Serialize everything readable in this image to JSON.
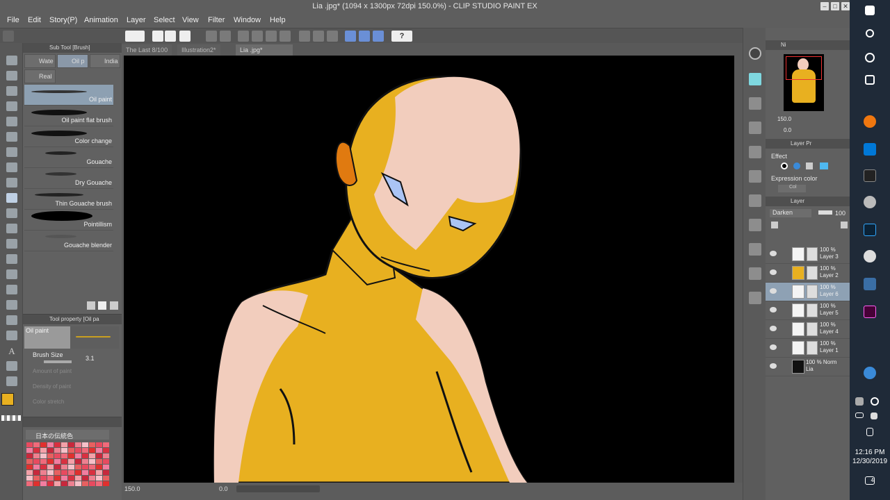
{
  "window": {
    "title": "Lia .jpg* (1094 x 1300px 72dpi 150.0%) - CLIP STUDIO PAINT EX",
    "min": "–",
    "max": "□",
    "close": "✕"
  },
  "menu": [
    "File",
    "Edit",
    "Story(P)",
    "Animation",
    "Layer",
    "Select",
    "View",
    "Filter",
    "Window",
    "Help"
  ],
  "doc_tabs": [
    "The Last",
    "8/100",
    "Illustration2*",
    "Lia .jpg*"
  ],
  "subtool": {
    "header": "Sub Tool [Brush]",
    "tabs": [
      "Wate",
      "Oil p",
      "India",
      "Real"
    ],
    "brushes": [
      "Oil paint",
      "Oil paint flat brush",
      "Color change",
      "Gouache",
      "Dry Gouache",
      "Thin Gouache brush",
      "Pointillism",
      "Gouache blender"
    ]
  },
  "toolprop": {
    "header": "Tool property [Oil pa",
    "preset": "Oil paint",
    "brush_size_label": "Brush Size",
    "brush_size_value": "3.1",
    "faded": [
      "Amount of paint",
      "Density of paint",
      "Color stretch"
    ]
  },
  "colorset": {
    "name": "日本の伝統色"
  },
  "status": {
    "zoom": "150.0",
    "angle": "0.0"
  },
  "navigator": {
    "tab": "Ni",
    "zoom": "150.0",
    "angle": "0.0"
  },
  "layer_property": {
    "tab": "Layer Pr",
    "effect_label": "Effect",
    "expression_label": "Expression color",
    "expression_value": "Col"
  },
  "layers": {
    "tab": "Layer",
    "blend": "Darken",
    "opacity": "100",
    "rows": [
      {
        "pct": "100 %",
        "name": "Layer 3"
      },
      {
        "pct": "100 %",
        "name": "Layer 2"
      },
      {
        "pct": "100 %",
        "name": "Layer 6"
      },
      {
        "pct": "100 %",
        "name": "Layer 5"
      },
      {
        "pct": "100 %",
        "name": "Layer 4"
      },
      {
        "pct": "100 %",
        "name": "Layer 1"
      },
      {
        "pct": "100 % Norm",
        "name": "Lia"
      }
    ]
  },
  "taskbar": {
    "time": "12:16 PM",
    "date": "12/30/2019",
    "notifications": "4"
  },
  "colors": {
    "main": "#e8b020",
    "skin": "#f2cdbd",
    "accent": "#e07a10",
    "eye": "#aac4f4"
  }
}
